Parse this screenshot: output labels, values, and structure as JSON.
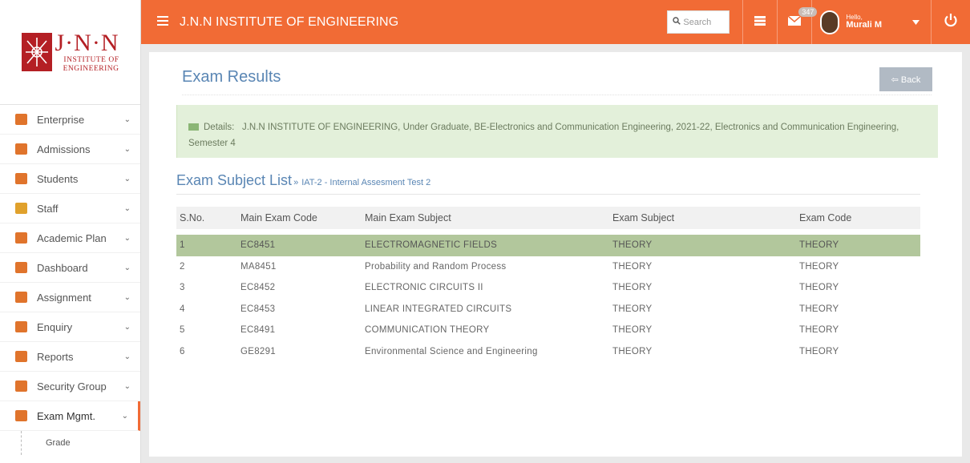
{
  "app": {
    "title": "J.N.N INSTITUTE OF ENGINEERING",
    "accent_color": "#f16b35"
  },
  "logo": {
    "big_text": "J·N·N",
    "small_text_line1": "INSTITUTE OF",
    "small_text_line2": "ENGINEERING"
  },
  "topbar": {
    "search_placeholder": "Search",
    "mail_badge": "347",
    "hello": "Hello,",
    "user_name": "Murali M"
  },
  "sidebar": {
    "items": [
      {
        "label": "Enterprise",
        "icon": "gears-icon",
        "color": "#e0742c"
      },
      {
        "label": "Admissions",
        "icon": "list-icon",
        "color": "#e0742c"
      },
      {
        "label": "Students",
        "icon": "users-icon",
        "color": "#e0742c"
      },
      {
        "label": "Staff",
        "icon": "user-icon",
        "color": "#e0a12c"
      },
      {
        "label": "Academic Plan",
        "icon": "book-icon",
        "color": "#e0742c"
      },
      {
        "label": "Dashboard",
        "icon": "dashboard-icon",
        "color": "#e0742c"
      },
      {
        "label": "Assignment",
        "icon": "tag-icon",
        "color": "#e0742c"
      },
      {
        "label": "Enquiry",
        "icon": "phone-icon",
        "color": "#e0742c"
      },
      {
        "label": "Reports",
        "icon": "folder-icon",
        "color": "#e0742c"
      },
      {
        "label": "Security Group",
        "icon": "shield-icon",
        "color": "#e0742c"
      },
      {
        "label": "Exam Mgmt.",
        "icon": "edit-icon",
        "color": "#e0742c"
      }
    ],
    "sub_items": [
      {
        "label": "Grade"
      }
    ]
  },
  "page": {
    "title": "Exam Results",
    "back_label": "Back",
    "details_label": "Details:",
    "details_text": "J.N.N INSTITUTE OF ENGINEERING, Under Graduate, BE-Electronics and Communication Engineering, 2021-22, Electronics and Communication Engineering, Semester 4",
    "subject_list_title": "Exam Subject List",
    "raquo": "»",
    "exam_name": "IAT-2 - Internal Assesment Test 2"
  },
  "table": {
    "headers": [
      "S.No.",
      "Main Exam Code",
      "Main Exam Subject",
      "Exam Subject",
      "Exam Code"
    ],
    "rows": [
      [
        "1",
        "EC8451",
        "ELECTROMAGNETIC FIELDS",
        "THEORY",
        "THEORY"
      ],
      [
        "2",
        "MA8451",
        "Probability and Random Process",
        "THEORY",
        "THEORY"
      ],
      [
        "3",
        "EC8452",
        "ELECTRONIC CIRCUITS II",
        "THEORY",
        "THEORY"
      ],
      [
        "4",
        "EC8453",
        "LINEAR INTEGRATED CIRCUITS",
        "THEORY",
        "THEORY"
      ],
      [
        "5",
        "EC8491",
        "COMMUNICATION THEORY",
        "THEORY",
        "THEORY"
      ],
      [
        "6",
        "GE8291",
        "Environmental Science and Engineering",
        "THEORY",
        "THEORY"
      ]
    ]
  }
}
